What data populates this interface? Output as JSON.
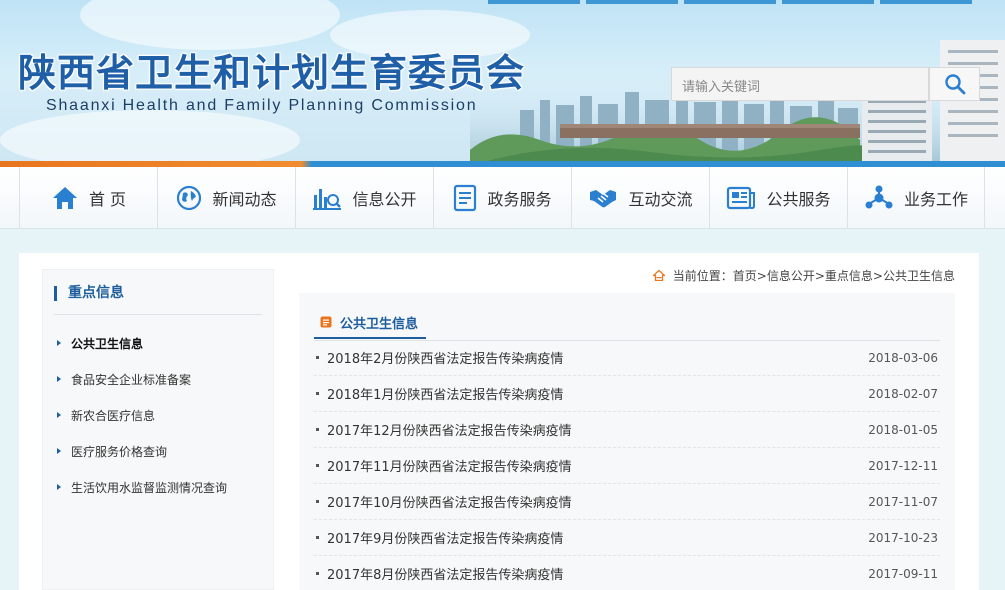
{
  "header": {
    "title": "陕西省卫生和计划生育委员会",
    "subtitle": "Shaanxi Health and Family Planning Commission",
    "search_placeholder": "请输入关键词"
  },
  "nav": {
    "items": [
      {
        "label": "首 页",
        "icon": "home-icon"
      },
      {
        "label": "新闻动态",
        "icon": "globe-icon"
      },
      {
        "label": "信息公开",
        "icon": "bar-chart-search-icon"
      },
      {
        "label": "政务服务",
        "icon": "document-icon"
      },
      {
        "label": "互动交流",
        "icon": "handshake-icon"
      },
      {
        "label": "公共服务",
        "icon": "newspaper-icon"
      },
      {
        "label": "业务工作",
        "icon": "network-icon"
      }
    ]
  },
  "sidebar": {
    "title": "重点信息",
    "items": [
      {
        "label": "公共卫生信息",
        "active": true
      },
      {
        "label": "食品安全企业标准备案",
        "active": false
      },
      {
        "label": "新农合医疗信息",
        "active": false
      },
      {
        "label": "医疗服务价格查询",
        "active": false
      },
      {
        "label": "生活饮用水监督监测情况查询",
        "active": false
      }
    ]
  },
  "breadcrumb": {
    "prefix": "当前位置：",
    "items": [
      "首页",
      "信息公开",
      "重点信息",
      "公共卫生信息"
    ],
    "sep": ">"
  },
  "content": {
    "tab_label": "公共卫生信息",
    "news": [
      {
        "title": "2018年2月份陕西省法定报告传染病疫情",
        "date": "2018-03-06"
      },
      {
        "title": "2018年1月份陕西省法定报告传染病疫情",
        "date": "2018-02-07"
      },
      {
        "title": "2017年12月份陕西省法定报告传染病疫情",
        "date": "2018-01-05"
      },
      {
        "title": "2017年11月份陕西省法定报告传染病疫情",
        "date": "2017-12-11"
      },
      {
        "title": "2017年10月份陕西省法定报告传染病疫情",
        "date": "2017-11-07"
      },
      {
        "title": "2017年9月份陕西省法定报告传染病疫情",
        "date": "2017-10-23"
      },
      {
        "title": "2017年8月份陕西省法定报告传染病疫情",
        "date": "2017-09-11"
      }
    ]
  },
  "colors": {
    "brand_blue": "#1f5e9e",
    "nav_icon_blue": "#2a7fd0",
    "accent_orange": "#e8761f",
    "page_bg": "#e6f3f7"
  }
}
